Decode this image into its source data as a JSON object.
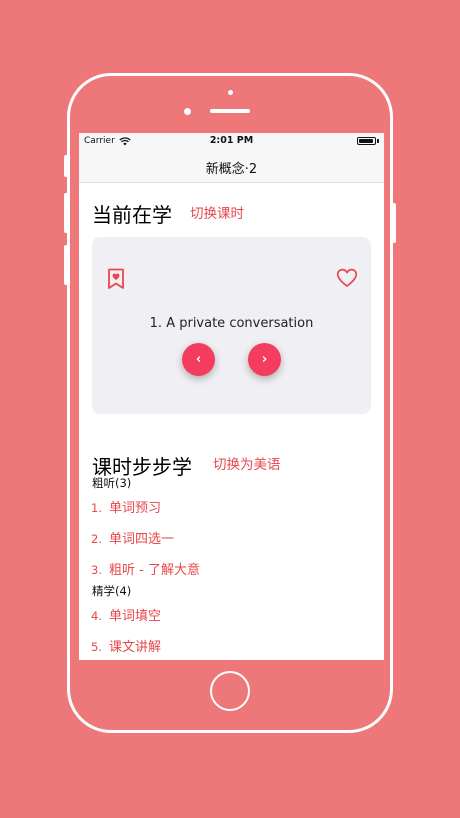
{
  "status_bar": {
    "carrier": "Carrier",
    "time": "2:01 PM",
    "battery_level": 0.9
  },
  "nav": {
    "title": "新概念·2"
  },
  "current": {
    "title": "当前在学",
    "switch_label": "切换课时",
    "lesson_title": "1. A private conversation",
    "prev_symbol": "‹",
    "next_symbol": "›"
  },
  "steps_section": {
    "title": "课时步步学",
    "switch_label": "切换为美语",
    "groups": [
      {
        "label": "粗听(3)"
      },
      {
        "label": "精学(4)"
      }
    ],
    "steps": [
      {
        "num": "1.",
        "label": "单词预习"
      },
      {
        "num": "2.",
        "label": "单词四选一"
      },
      {
        "num": "3.",
        "label": "粗听 - 了解大意"
      },
      {
        "num": "4.",
        "label": "单词填空"
      },
      {
        "num": "5.",
        "label": "课文讲解"
      }
    ]
  },
  "colors": {
    "background": "#ee777a",
    "accent": "#e8474b",
    "button": "#f43d5e",
    "card": "#f0eff4"
  },
  "icons": {
    "bookmark": "bookmark-heart-icon",
    "favorite": "heart-icon",
    "wifi": "wifi-icon",
    "battery": "battery-icon"
  }
}
